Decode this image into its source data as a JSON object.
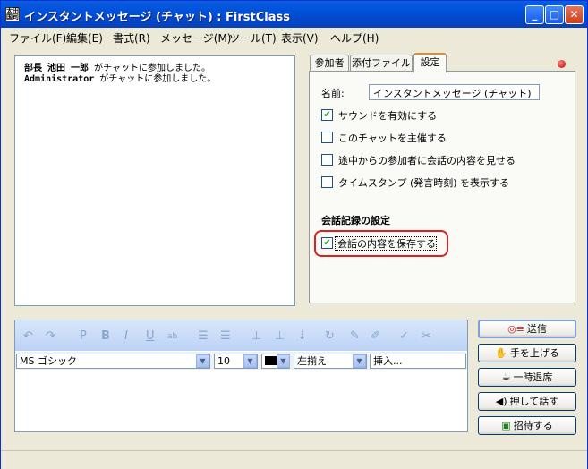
{
  "window": {
    "title": "インスタントメッセージ (チャット) : FirstClass",
    "icon_text": "太田\n国司",
    "controls": [
      "minimize-icon",
      "maximize-icon",
      "close-icon"
    ]
  },
  "menu": {
    "items": [
      "ファイル(F)",
      "編集(E)",
      "書式(R)",
      "メッセージ(M)",
      "ツール(T)",
      "表示(V)",
      "ヘルプ(H)"
    ]
  },
  "chat": {
    "lines": [
      {
        "name": "部長 池田 一郎",
        "text": " がチャットに参加しました。"
      },
      {
        "name": "Administrator",
        "text": " がチャットに参加しました。"
      }
    ]
  },
  "tabs": [
    "参加者",
    "添付ファイル",
    "設定"
  ],
  "active_tab": "設定",
  "settings": {
    "name_label": "名前:",
    "name_value": "インスタントメッセージ (チャット)",
    "options": [
      {
        "label": "サウンドを有効にする",
        "checked": true
      },
      {
        "label": "このチャットを主催する",
        "checked": false
      },
      {
        "label": "途中からの参加者に会話の内容を見せる",
        "checked": false
      },
      {
        "label": "タイムスタンプ (発言時刻) を表示する",
        "checked": false
      }
    ],
    "log_section_title": "会話記録の設定",
    "save_option": {
      "label": "会話の内容を保存する",
      "checked": true
    },
    "highlight_color": "#e02020"
  },
  "format": {
    "font": "MS ゴシック",
    "size": "10",
    "color": "#000000",
    "align": "左揃え",
    "insert": "挿入..."
  },
  "buttons": {
    "send": "送信",
    "raise_hand": "手を上げる",
    "leave": "一時退席",
    "push_to_talk": "押して話す",
    "invite": "招待する"
  }
}
